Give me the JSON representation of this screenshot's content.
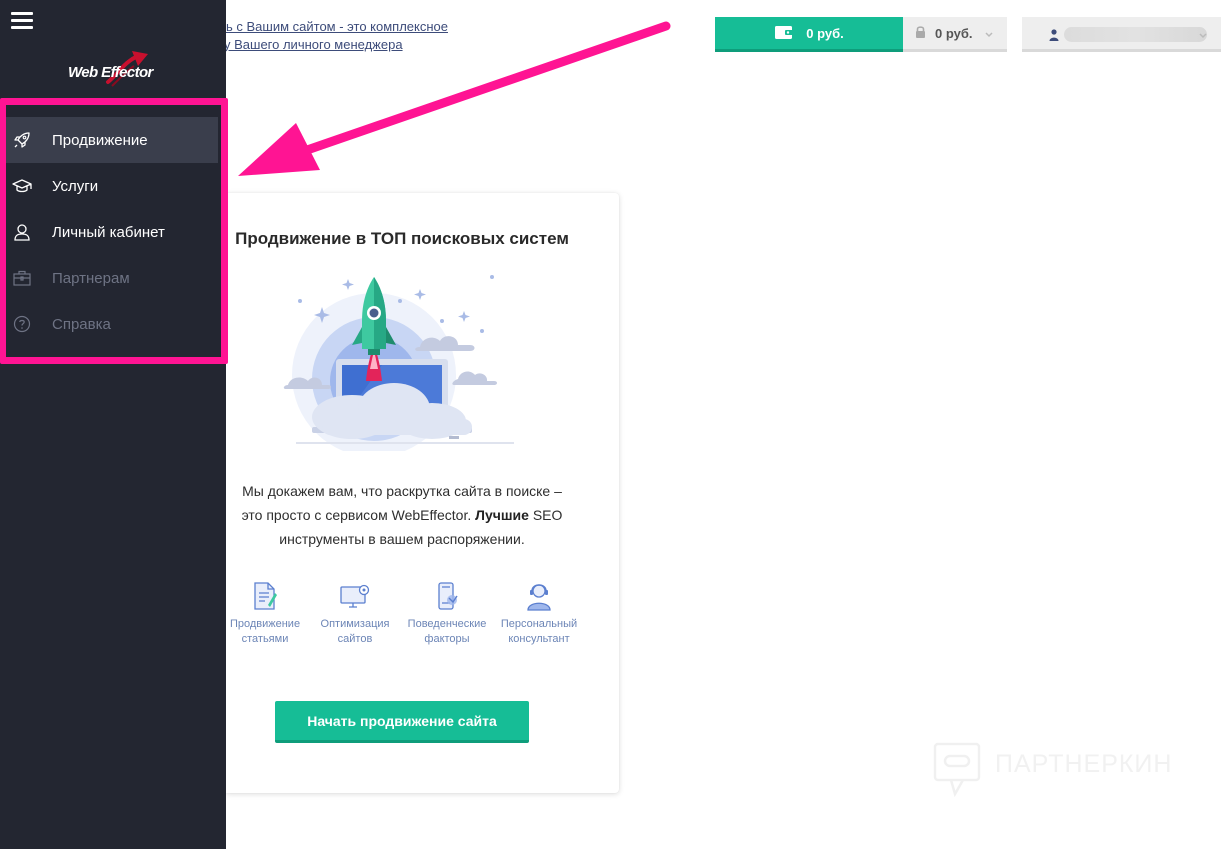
{
  "sidebar": {
    "logo_text": "Web Effector",
    "items": [
      {
        "label": "Продвижение",
        "icon": "rocket-icon",
        "state": "active"
      },
      {
        "label": "Услуги",
        "icon": "graduation-cap-icon",
        "state": "normal"
      },
      {
        "label": "Личный кабинет",
        "icon": "user-icon",
        "state": "normal"
      },
      {
        "label": "Партнерам",
        "icon": "briefcase-icon",
        "state": "disabled"
      },
      {
        "label": "Справка",
        "icon": "help-circle-icon",
        "state": "disabled"
      }
    ]
  },
  "header": {
    "link_line1": "ь с Вашим сайтом - это комплексное",
    "link_line2": "у Вашего личного менеджера",
    "balance": "0 руб.",
    "locked_balance": "0 руб."
  },
  "card": {
    "title": "Продвижение в ТОП поисковых систем",
    "desc_part1": "Мы докажем вам, что раскрутка сайта в поиске –",
    "desc_part2": "это просто с сервисом WebEffector.",
    "desc_bold": "Лучшие",
    "desc_part3": "SEO",
    "desc_part4": "инструменты в вашем распоряжении.",
    "features": [
      {
        "line1": "Продвижение",
        "line2": "статьями",
        "icon": "article-icon"
      },
      {
        "line1": "Оптимизация",
        "line2": "сайтов",
        "icon": "monitor-settings-icon"
      },
      {
        "line1": "Поведенческие",
        "line2": "факторы",
        "icon": "phone-touch-icon"
      },
      {
        "line1": "Персональный",
        "line2": "консультант",
        "icon": "consultant-icon"
      }
    ],
    "cta_label": "Начать продвижение сайта"
  },
  "watermark": {
    "text": "ПАРТНЕРКИН"
  },
  "colors": {
    "accent": "#16bd96",
    "sidebar": "#232631",
    "highlight": "#ff1493"
  }
}
